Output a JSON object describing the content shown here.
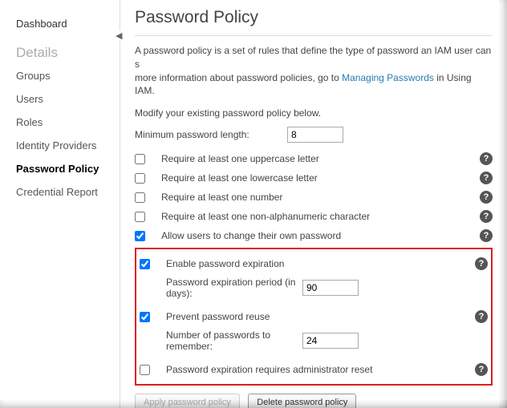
{
  "sidebar": {
    "dashboard": "Dashboard",
    "heading": "Details",
    "items": [
      {
        "label": "Groups"
      },
      {
        "label": "Users"
      },
      {
        "label": "Roles"
      },
      {
        "label": "Identity Providers"
      },
      {
        "label": "Password Policy",
        "active": true
      },
      {
        "label": "Credential Report"
      }
    ]
  },
  "main": {
    "title": "Password Policy",
    "desc_part1": "A password policy is a set of rules that define the type of password an IAM user can s",
    "desc_part2": "more information about password policies, go to ",
    "desc_link": "Managing Passwords",
    "desc_part3": " in Using IAM.",
    "modify": "Modify your existing password policy below.",
    "min_length_label": "Minimum password length:",
    "min_length_value": "8",
    "options": [
      {
        "label": "Require at least one uppercase letter",
        "checked": false
      },
      {
        "label": "Require at least one lowercase letter",
        "checked": false
      },
      {
        "label": "Require at least one number",
        "checked": false
      },
      {
        "label": "Require at least one non-alphanumeric character",
        "checked": false
      },
      {
        "label": "Allow users to change their own password",
        "checked": true
      }
    ],
    "highlighted": {
      "enable_expiration": {
        "label": "Enable password expiration",
        "checked": true
      },
      "expiration_period_label": "Password expiration period (in days):",
      "expiration_period_value": "90",
      "prevent_reuse": {
        "label": "Prevent password reuse",
        "checked": true
      },
      "remember_label": "Number of passwords to remember:",
      "remember_value": "24",
      "admin_reset": {
        "label": "Password expiration requires administrator reset",
        "checked": false
      }
    },
    "buttons": {
      "apply": "Apply password policy",
      "delete": "Delete password policy"
    }
  }
}
